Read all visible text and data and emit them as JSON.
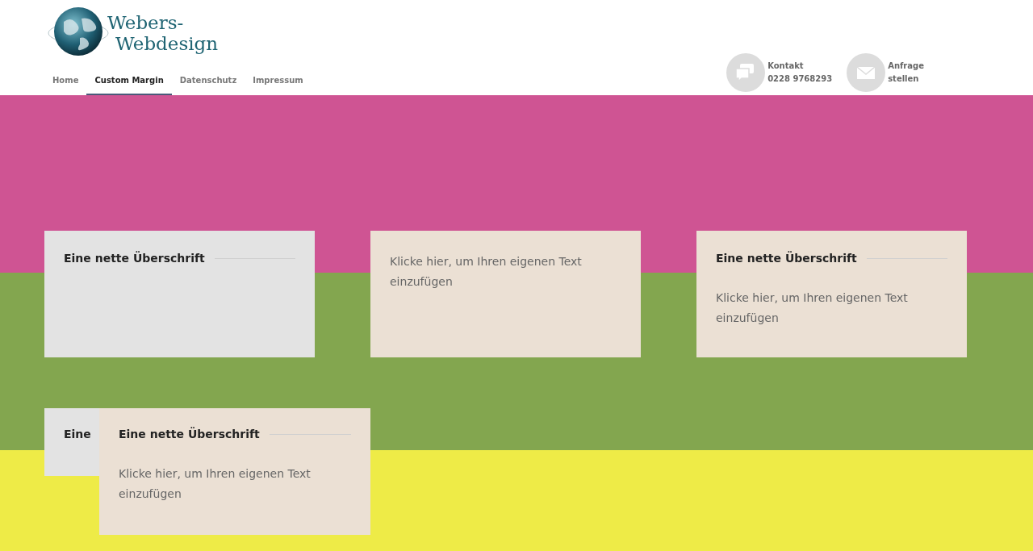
{
  "logo": {
    "line_1": "Webers-",
    "line_2": "Webdesign"
  },
  "nav": [
    {
      "label": "Home",
      "selected": false
    },
    {
      "label": "Custom Margin",
      "selected": true
    },
    {
      "label": "Datenschutz",
      "selected": false
    },
    {
      "label": "Impressum",
      "selected": false
    }
  ],
  "contacts": [
    {
      "kind": "chat",
      "line_1": "Kontakt",
      "line_2": "0228 9768293"
    },
    {
      "kind": "mail",
      "line_1": "Anfrage",
      "line_2": "stellen"
    }
  ],
  "bands": [
    {
      "color": "#cf5493"
    },
    {
      "color": "#83a64f"
    },
    {
      "color": "#eeeb47"
    }
  ],
  "row_1": [
    {
      "color": "#e3e3e3",
      "heading": "Eine nette Überschrift"
    },
    {
      "color": "#ebe0d4",
      "text": "Klicke hier, um Ihren eigenen Text einzufügen"
    },
    {
      "color": "#ebe0d4",
      "heading": "Eine nette Überschrift",
      "text": "Klicke hier, um Ihren eigenen Text einzufügen"
    }
  ],
  "row_2": [
    {
      "color": "#e3e3e3",
      "heading": "Eine"
    },
    {
      "color": "#ebe0d4",
      "heading": "Eine nette Überschrift",
      "text": "Klicke hier, um Ihren eigenen Text einzufügen"
    }
  ]
}
